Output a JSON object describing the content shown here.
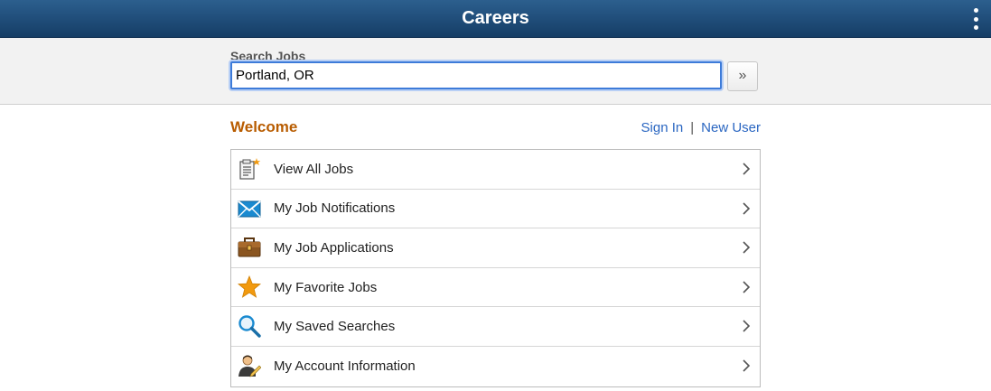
{
  "header": {
    "title": "Careers",
    "menu_icon": "kebab-menu-icon"
  },
  "search": {
    "label": "Search Jobs",
    "value": "Portland, OR",
    "go_label": "»"
  },
  "welcome": {
    "title": "Welcome",
    "sign_in": "Sign In",
    "separator": "|",
    "new_user": "New User"
  },
  "menu": {
    "items": [
      {
        "label": "View All Jobs",
        "icon": "job-list-icon"
      },
      {
        "label": "My Job Notifications",
        "icon": "envelope-icon"
      },
      {
        "label": "My Job Applications",
        "icon": "briefcase-icon"
      },
      {
        "label": "My Favorite Jobs",
        "icon": "star-icon"
      },
      {
        "label": "My Saved Searches",
        "icon": "magnifier-icon"
      },
      {
        "label": "My Account Information",
        "icon": "user-account-icon"
      }
    ]
  },
  "colors": {
    "header": "#1f4c78",
    "accent": "#b85c00",
    "link": "#2a66c1",
    "focus": "#3d7bd9"
  }
}
